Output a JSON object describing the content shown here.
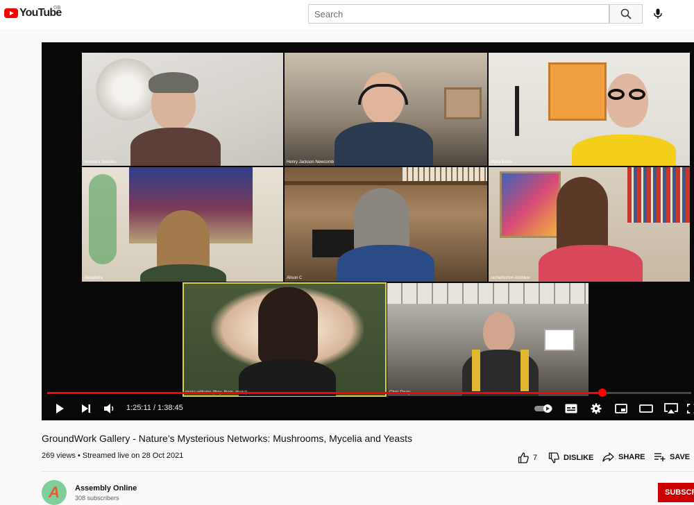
{
  "header": {
    "logo_text": "YouTube",
    "country_code": "GB",
    "search_placeholder": "Search"
  },
  "video": {
    "participants": [
      "Veronica Sekules",
      "Henry Jackson Newcomb",
      "Myka Baum",
      "Alexandra",
      "Alison C",
      "rachelhorton-kitchlew",
      "moira williams (they, them, moira)",
      "Chris Drury"
    ],
    "controls": {
      "time_display": "1:25:11 / 1:38:45",
      "progress_fraction": 0.862
    }
  },
  "info": {
    "title": "GroundWork Gallery - Nature’s Mysterious Networks: Mushrooms, Mycelia and Yeasts",
    "meta": "269 views • Streamed live on 28 Oct 2021",
    "like_count": "7",
    "dislike_label": "DISLIKE",
    "share_label": "SHARE",
    "save_label": "SAVE"
  },
  "channel": {
    "name": "Assembly Online",
    "subscribers": "308 subscribers",
    "avatar_letter": "A",
    "subscribe_label": "SUBSCR"
  },
  "colors": {
    "brand_red": "#ff0000",
    "speaker_highlight": "#d8d44a",
    "subscribe_bg": "#cc0000"
  }
}
